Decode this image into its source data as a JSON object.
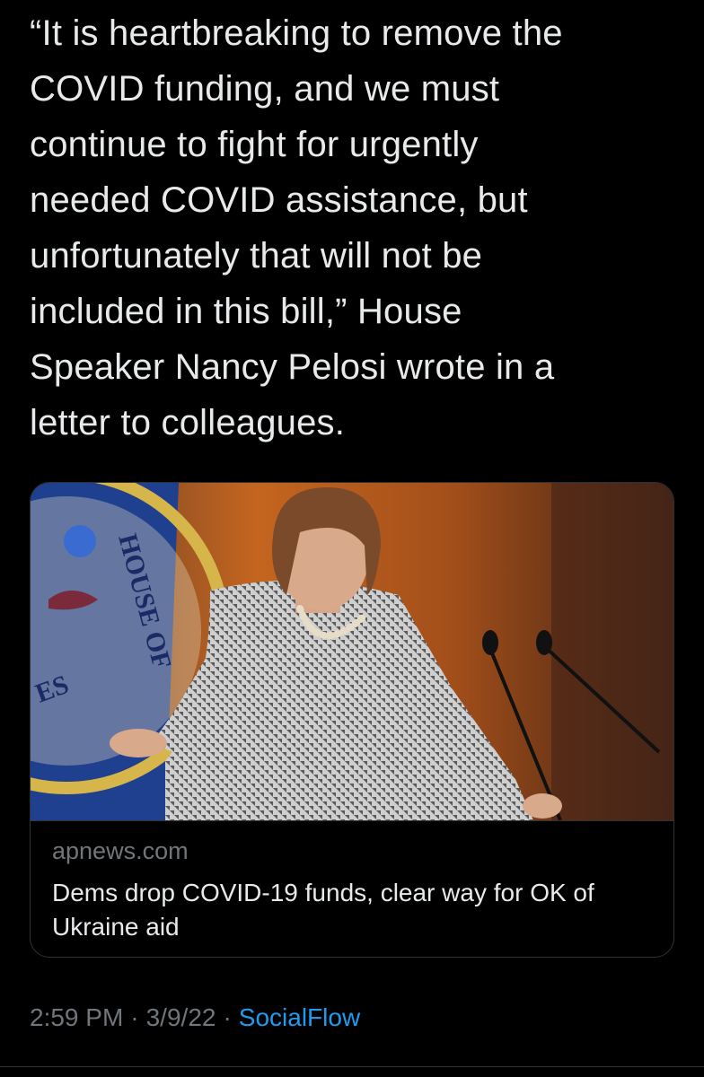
{
  "tweet": {
    "text": "“It is heartbreaking to remove the\nCOVID funding, and we must\ncontinue to fight for urgently\nneeded COVID assistance, but\nunfortunately that will not be\nincluded in this bill,” House\nSpeaker Nancy Pelosi wrote in a\nletter to colleagues."
  },
  "card": {
    "image_alt": "Nancy Pelosi speaking at a podium in front of a House of Representatives flag",
    "seal_text": "HOUSE OF",
    "seal_text_small": "ES",
    "domain": "apnews.com",
    "title": "Dems drop COVID-19 funds, clear way for OK of Ukraine aid"
  },
  "meta": {
    "time": "2:59 PM",
    "separator": "·",
    "date": "3/9/22",
    "source": "SocialFlow"
  },
  "colors": {
    "background": "#000000",
    "text": "#e7e9ea",
    "secondary": "#71767b",
    "link": "#1d9bf0",
    "border": "#2f3336"
  }
}
